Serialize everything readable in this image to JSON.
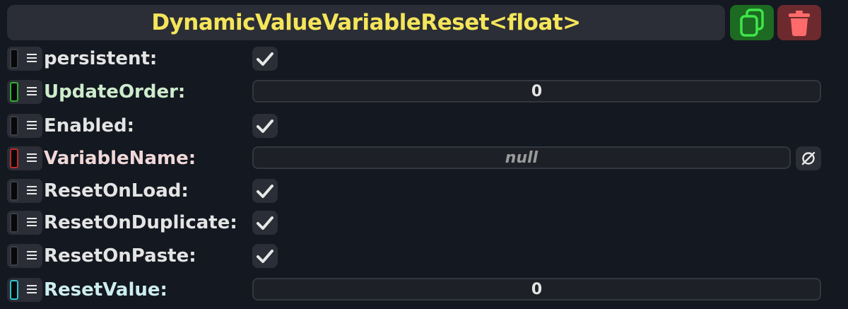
{
  "header": {
    "title": "DynamicValueVariableReset<float>",
    "duplicate_icon": "duplicate-icon",
    "delete_icon": "trash-icon"
  },
  "colors": {
    "title": "#f5e55a",
    "bool_slot": "#3a3d44",
    "int_slot": "#2fb12f",
    "string_slot": "#c02a2a",
    "float_slot": "#2ec4cf",
    "label_int": "#cdeccd",
    "label_string": "#f0d8d8",
    "label_float": "#cdeef0"
  },
  "fields": [
    {
      "label": "persistent:",
      "type": "checkbox",
      "checked": true
    },
    {
      "label": "UpdateOrder:",
      "type": "number",
      "value": "0"
    },
    {
      "label": "Enabled:",
      "type": "checkbox",
      "checked": true
    },
    {
      "label": "VariableName:",
      "type": "text",
      "value": "null",
      "null_icon": "null-icon"
    },
    {
      "label": "ResetOnLoad:",
      "type": "checkbox",
      "checked": true
    },
    {
      "label": "ResetOnDuplicate:",
      "type": "checkbox",
      "checked": true
    },
    {
      "label": "ResetOnPaste:",
      "type": "checkbox",
      "checked": true
    },
    {
      "label": "ResetValue:",
      "type": "number",
      "value": "0"
    }
  ]
}
